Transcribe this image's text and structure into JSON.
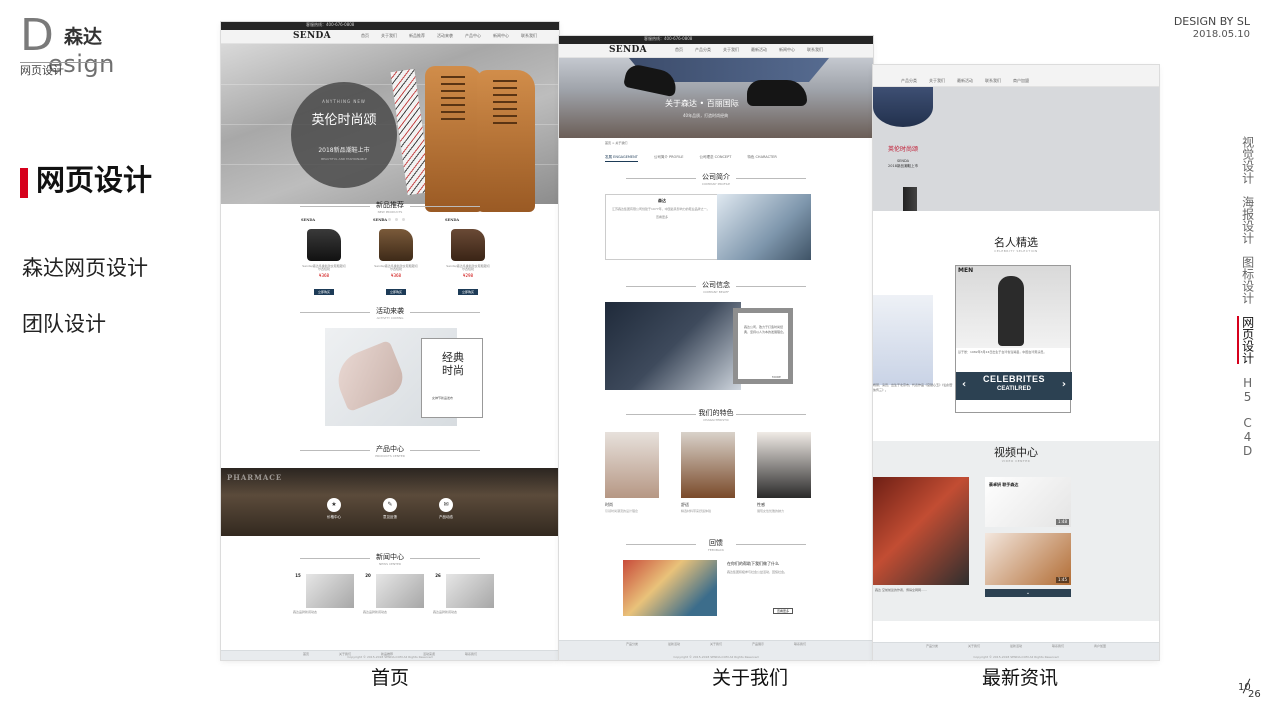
{
  "brand": {
    "letter": "D",
    "cn": "森达",
    "en": "esign",
    "sub": "网页设计"
  },
  "section": {
    "title": "网页设计",
    "items": [
      "森达网页设计",
      "团队设计"
    ]
  },
  "byline": {
    "by": "DESIGN BY SL",
    "date": "2018.05.10"
  },
  "side_nav": {
    "items": [
      {
        "label": "视觉设计",
        "active": false
      },
      {
        "label": "海报设计",
        "active": false
      },
      {
        "label": "图标设计",
        "active": false
      },
      {
        "label": "网页设计",
        "active": true
      },
      {
        "label": "H5",
        "active": false
      },
      {
        "label": "C4D",
        "active": false
      }
    ]
  },
  "pager": {
    "current": "10",
    "total": "26"
  },
  "captions": {
    "home": "首页",
    "about": "关于我们",
    "news": "最新资讯"
  },
  "home": {
    "topbar": "客服热线：400-676-0808",
    "logo": "SENDA",
    "nav": [
      "首页",
      "关于我们",
      "新品推荐",
      "活动来袭",
      "产品中心",
      "新闻中心",
      "联系我们"
    ],
    "hero": {
      "en": "ANYTHING NEW",
      "title": "英伦时尚颂",
      "sub": "2018新品潮鞋上市",
      "sub2": "BEAUTIFUL AND FASHIONABLE"
    },
    "new_products": {
      "title": "新品推荐",
      "en": "NEW PRODUCTS",
      "items": [
        {
          "logo": "SENDA",
          "desc": "Senda/森达冬季新款女鞋粗跟切尔西短靴",
          "price": "¥368",
          "btn": "立即购买"
        },
        {
          "logo": "SENDA",
          "desc": "Senda/森达冬季新款女鞋粗跟切尔西短靴",
          "price": "¥368",
          "btn": "立即购买"
        },
        {
          "logo": "SENDA",
          "desc": "Senda/森达冬季新款女鞋粗跟切尔西短靴",
          "price": "¥298",
          "btn": "立即购买"
        }
      ]
    },
    "events": {
      "title": "活动来袭",
      "en": "ACTIVITY COMING",
      "card_title": "经典时尚",
      "card_sub": "女神节新品发布"
    },
    "products": {
      "title": "产品中心",
      "en": "PRODUCTS CENTER",
      "sign": "PHARMACE",
      "items": [
        {
          "icon": "★",
          "label": "价格中心"
        },
        {
          "icon": "✎",
          "label": "意见反馈"
        },
        {
          "icon": "✉",
          "label": "产品动态"
        }
      ]
    },
    "news": {
      "title": "新闻中心",
      "en": "NEWS CENTER",
      "items": [
        {
          "date": "15",
          "desc": "森达品牌新闻动态"
        },
        {
          "date": "20",
          "desc": "森达品牌新闻动态"
        },
        {
          "date": "26",
          "desc": "森达品牌新闻动态"
        }
      ]
    },
    "footer_links": [
      "首页",
      "关于我们",
      "新品推荐",
      "活动来袭",
      "联系我们"
    ],
    "copyright": "Copyright © 2015-2018 SENDA.COM All Rights Reserved"
  },
  "about": {
    "topbar": "客服热线：400-676-0808",
    "logo": "SENDA",
    "nav": [
      "首页",
      "产品分类",
      "关于我们",
      "最新活动",
      "新闻中心",
      "联系我们"
    ],
    "hero": {
      "title": "关于森达 • 百丽国际",
      "sub": "40年品质，打造时尚经典"
    },
    "crumb": "首页 > 关于我们",
    "tabs": [
      "发展 ENGAGEMENT",
      "公司简介 PROFILE",
      "公司理念 CONCEPT",
      "特色 CHARACTER"
    ],
    "intro": {
      "title": "公司简介",
      "en": "COMPANY PROFILE",
      "name": "森达",
      "text": "江苏森达集团有限公司创建于1977年，中国最具影响力的鞋业品牌之一。",
      "more": "查看更多"
    },
    "belief": {
      "title": "公司信念",
      "en": "COMPANY BELIEF",
      "text": "森达公司，致力于打造时尚经典，坚持以人为本的发展理念。",
      "more": "MORE"
    },
    "features": {
      "title": "我们的特色",
      "en": "CHARACTERISTIC",
      "items": [
        {
          "label": "时尚",
          "desc": "引领时尚潮流的设计理念"
        },
        {
          "label": "舒适",
          "desc": "精选材料带来舒适体验"
        },
        {
          "label": "性感",
          "desc": "展现女性优雅的魅力"
        }
      ]
    },
    "charity": {
      "title": "回馈",
      "en": "FEEDBACK",
      "heading": "在你们的帮助下我们做了什么",
      "text": "森达集团积极参与社会公益活动，回馈社会。",
      "btn": "查看更多"
    },
    "footer_links": [
      "产品分类",
      "最新活动",
      "关于我们",
      "产品展示",
      "联系我们"
    ],
    "copyright": "Copyright © 2015-2018 SENDA.COM All Rights Reserved"
  },
  "news": {
    "nav": [
      "产品分类",
      "关于我们",
      "最新活动",
      "联系我们",
      "商户加盟"
    ],
    "hero": {
      "title": "英伦时尚颂",
      "sub": "SENDA",
      "sub2": "2018新品潮鞋上市"
    },
    "celebrity": {
      "title": "名人精选",
      "en": "CELEBRITY SELECTION",
      "mag": "MEN",
      "caption": "彭于晏：1982年3月24日出生于台湾省澎湖县，中国台湾男演员。",
      "btn_a": "CELEBRITES",
      "btn_b": "CEATILRED",
      "text": "杨幂，演员，出生于北京市。代表作品《宫锁心玉》《仙剑奇侠传三》。"
    },
    "video": {
      "title": "视频中心",
      "en": "VIDEO CENTER",
      "card_title": "蔡卓妍 联手森达",
      "durations": [
        "1:48",
        "1:45"
      ],
      "caption": "森达 空前前途的作者，博得全网网……",
      "bar": "⌄"
    },
    "footer_links": [
      "产品分类",
      "关于我们",
      "最新活动",
      "联系我们",
      "商户加盟"
    ],
    "copyright": "Copyright © 2015-2018 SENDA.COM All Rights Reserved"
  }
}
